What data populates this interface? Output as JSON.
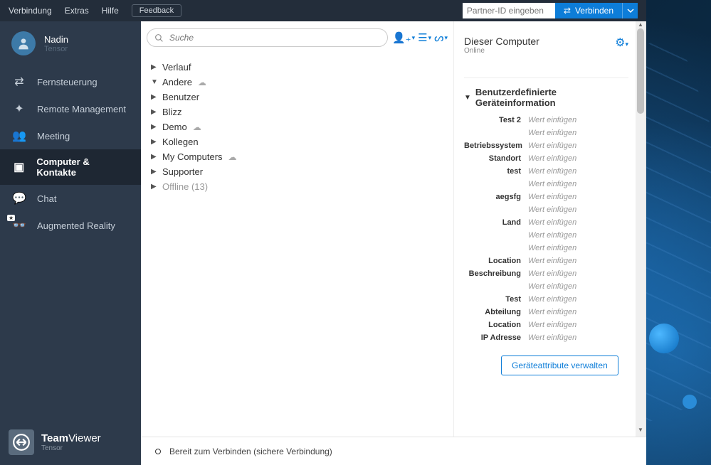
{
  "menubar": {
    "items": [
      "Verbindung",
      "Extras",
      "Hilfe"
    ],
    "feedback": "Feedback",
    "partner_placeholder": "Partner-ID eingeben",
    "connect": "Verbinden"
  },
  "profile": {
    "name": "Nadin",
    "sub": "Tensor"
  },
  "nav": {
    "remote_control": "Fernsteuerung",
    "remote_mgmt": "Remote Management",
    "meeting": "Meeting",
    "computers": "Computer & Kontakte",
    "chat": "Chat",
    "ar": "Augmented Reality"
  },
  "brand": {
    "line1a": "Team",
    "line1b": "Viewer",
    "line2": "Tensor"
  },
  "search": {
    "placeholder": "Suche"
  },
  "groups": [
    {
      "label": "Verlauf",
      "expanded": false,
      "cloud": false,
      "disabled": false
    },
    {
      "label": "Andere",
      "expanded": true,
      "cloud": true,
      "disabled": false
    },
    {
      "label": "Benutzer",
      "expanded": false,
      "cloud": false,
      "disabled": false
    },
    {
      "label": "Blizz",
      "expanded": false,
      "cloud": false,
      "disabled": false
    },
    {
      "label": "Demo",
      "expanded": false,
      "cloud": true,
      "disabled": false
    },
    {
      "label": "Kollegen",
      "expanded": false,
      "cloud": false,
      "disabled": false
    },
    {
      "label": "My Computers",
      "expanded": false,
      "cloud": true,
      "disabled": false
    },
    {
      "label": "Supporter",
      "expanded": false,
      "cloud": false,
      "disabled": false
    },
    {
      "label": "Offline (13)",
      "expanded": false,
      "cloud": false,
      "disabled": true
    }
  ],
  "right": {
    "title": "Dieser Computer",
    "status": "Online",
    "section_title": "Benutzerdefinierte Geräteinformation",
    "info_rows": [
      {
        "label": "Test 2",
        "value": "Wert einfügen"
      },
      {
        "label": "",
        "value": "Wert einfügen"
      },
      {
        "label": "Betriebssystem",
        "value": "Wert einfügen"
      },
      {
        "label": "Standort",
        "value": "Wert einfügen"
      },
      {
        "label": "test",
        "value": "Wert einfügen"
      },
      {
        "label": "",
        "value": "Wert einfügen"
      },
      {
        "label": "aegsfg",
        "value": "Wert einfügen"
      },
      {
        "label": "",
        "value": "Wert einfügen"
      },
      {
        "label": "Land",
        "value": "Wert einfügen"
      },
      {
        "label": "",
        "value": "Wert einfügen"
      },
      {
        "label": "",
        "value": "Wert einfügen"
      },
      {
        "label": "Location",
        "value": "Wert einfügen"
      },
      {
        "label": "Beschreibung",
        "value": "Wert einfügen"
      },
      {
        "label": "",
        "value": "Wert einfügen"
      },
      {
        "label": "Test",
        "value": "Wert einfügen"
      },
      {
        "label": "Abteilung",
        "value": "Wert einfügen"
      },
      {
        "label": "Location",
        "value": "Wert einfügen"
      },
      {
        "label": "IP Adresse",
        "value": "Wert einfügen"
      }
    ],
    "manage_button": "Geräteattribute verwalten"
  },
  "statusbar": {
    "text": "Bereit zum Verbinden (sichere Verbindung)"
  }
}
